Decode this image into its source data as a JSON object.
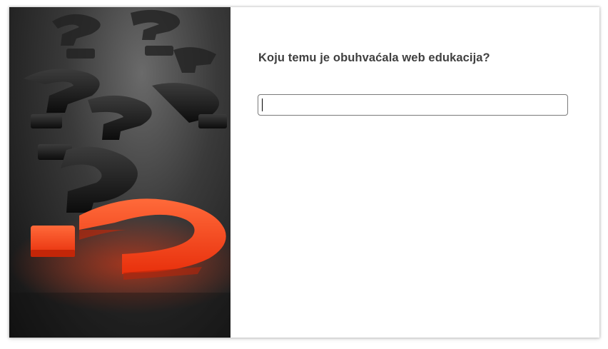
{
  "question": {
    "text": "Koju temu je obuhvaćala web edukacija?"
  },
  "answer": {
    "value": "",
    "placeholder": ""
  },
  "image": {
    "icon": "question-marks-image",
    "accent_color": "#ff4a1c",
    "dark_color": "#1a1a1a"
  }
}
